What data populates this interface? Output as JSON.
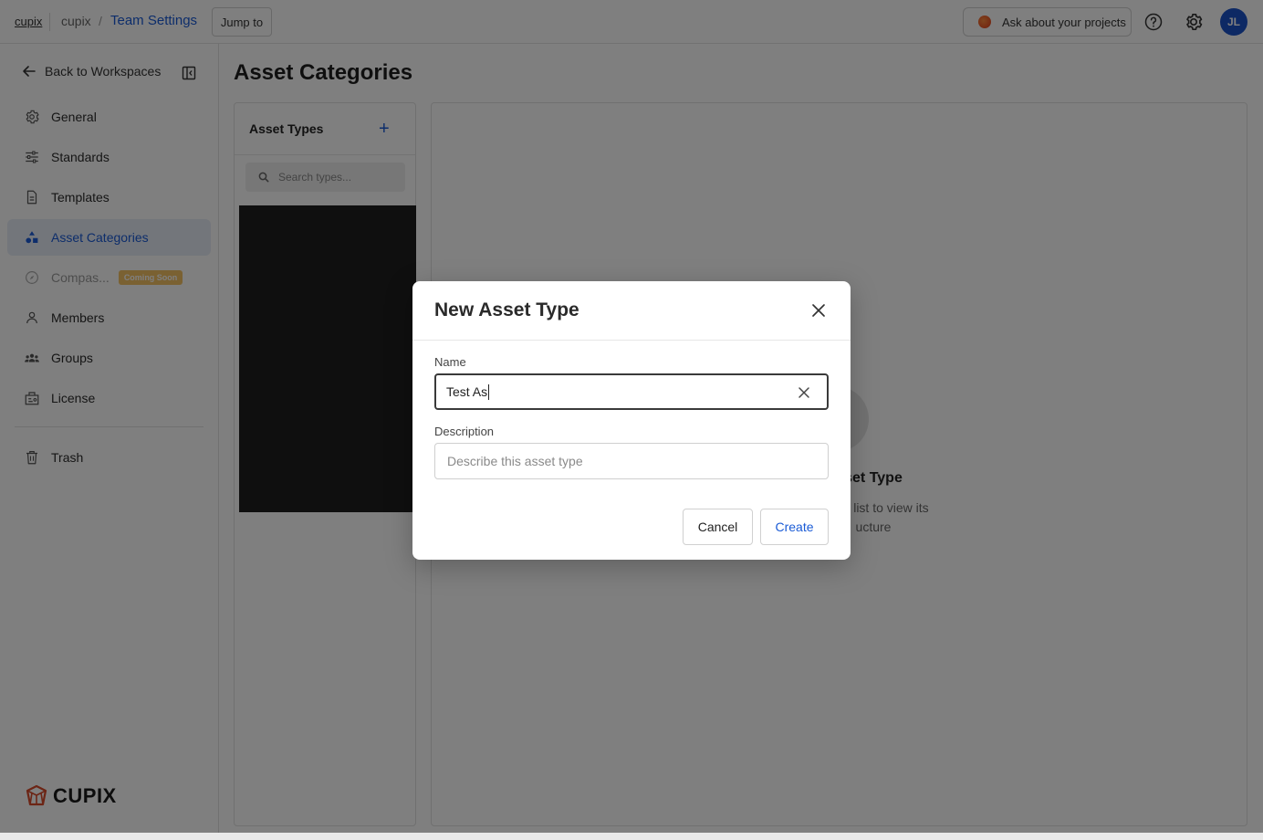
{
  "topbar": {
    "logo_text": "cupix",
    "workspace": "cupix",
    "separator": "/",
    "current": "Team Settings",
    "jump_label": "Jump to",
    "ask_label": "Ask about your projects",
    "avatar_initials": "JL"
  },
  "sidebar": {
    "back_label": "Back to Workspaces",
    "items": [
      {
        "label": "General",
        "icon": "gear-icon"
      },
      {
        "label": "Standards",
        "icon": "sliders-icon"
      },
      {
        "label": "Templates",
        "icon": "document-icon"
      },
      {
        "label": "Asset Categories",
        "icon": "shapes-icon",
        "active": true
      },
      {
        "label": "Compas...",
        "icon": "compass-icon",
        "badge": "Coming Soon",
        "disabled": true
      },
      {
        "label": "Members",
        "icon": "user-icon"
      },
      {
        "label": "Groups",
        "icon": "group-icon"
      },
      {
        "label": "License",
        "icon": "license-icon"
      },
      {
        "label": "Trash",
        "icon": "trash-icon"
      }
    ],
    "brand": "CUPIX"
  },
  "main": {
    "title": "Asset Categories",
    "types_panel": {
      "heading": "Asset Types",
      "add_symbol": "+",
      "search_placeholder": "Search types..."
    },
    "empty_state": {
      "title": "set Type",
      "line1": "m the list to view its",
      "line2": "ucture"
    }
  },
  "modal": {
    "title": "New Asset Type",
    "name_label": "Name",
    "name_value": "Test As",
    "description_label": "Description",
    "description_placeholder": "Describe this asset type",
    "cancel_label": "Cancel",
    "create_label": "Create"
  },
  "colors": {
    "accent": "#1a5bd6",
    "avatar": "#1a52c9",
    "badge": "#f5c265",
    "overlay": "rgba(0,0,0,0.5)"
  }
}
